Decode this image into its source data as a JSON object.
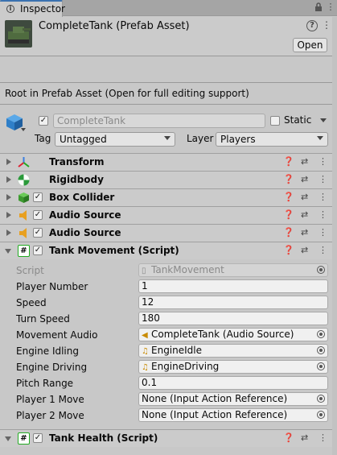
{
  "window": {
    "tab_label": "Inspector"
  },
  "header": {
    "title": "CompleteTank (Prefab Asset)",
    "open_label": "Open"
  },
  "info_text": "Root in Prefab Asset (Open for full editing support)",
  "gameobject": {
    "active": true,
    "name": "CompleteTank",
    "static_label": "Static",
    "static_checked": false,
    "tag_label": "Tag",
    "tag_value": "Untagged",
    "layer_label": "Layer",
    "layer_value": "Players"
  },
  "components": [
    {
      "name": "Transform",
      "icon": "transform-icon",
      "has_checkbox": false,
      "expanded": false
    },
    {
      "name": "Rigidbody",
      "icon": "rigidbody-icon",
      "has_checkbox": false,
      "expanded": false
    },
    {
      "name": "Box Collider",
      "icon": "box-collider-icon",
      "has_checkbox": true,
      "expanded": false
    },
    {
      "name": "Audio Source",
      "icon": "audio-source-icon",
      "has_checkbox": true,
      "expanded": false
    },
    {
      "name": "Audio Source",
      "icon": "audio-source-icon",
      "has_checkbox": true,
      "expanded": false
    },
    {
      "name": "Tank Movement (Script)",
      "icon": "script-icon",
      "has_checkbox": true,
      "expanded": true
    },
    {
      "name": "Tank Health (Script)",
      "icon": "script-icon",
      "has_checkbox": true,
      "expanded": true
    }
  ],
  "tank_movement": {
    "properties": [
      {
        "label": "Script",
        "value": "TankMovement",
        "kind": "script",
        "disabled": true
      },
      {
        "label": "Player Number",
        "value": "1",
        "kind": "number"
      },
      {
        "label": "Speed",
        "value": "12",
        "kind": "number"
      },
      {
        "label": "Turn Speed",
        "value": "180",
        "kind": "number"
      },
      {
        "label": "Movement Audio",
        "value": "CompleteTank (Audio Source)",
        "kind": "object",
        "icon": "audio-source-icon"
      },
      {
        "label": "Engine Idling",
        "value": "EngineIdle",
        "kind": "object",
        "icon": "audio-clip-icon"
      },
      {
        "label": "Engine Driving",
        "value": "EngineDriving",
        "kind": "object",
        "icon": "audio-clip-icon"
      },
      {
        "label": "Pitch Range",
        "value": "0.1",
        "kind": "number"
      },
      {
        "label": "Player 1 Move",
        "value": "None (Input Action Reference)",
        "kind": "object"
      },
      {
        "label": "Player 2 Move",
        "value": "None (Input Action Reference)",
        "kind": "object"
      }
    ]
  },
  "colors": {
    "accent": "#3a72b0",
    "panel": "#c8c8c8",
    "header": "#cbcbcb"
  }
}
